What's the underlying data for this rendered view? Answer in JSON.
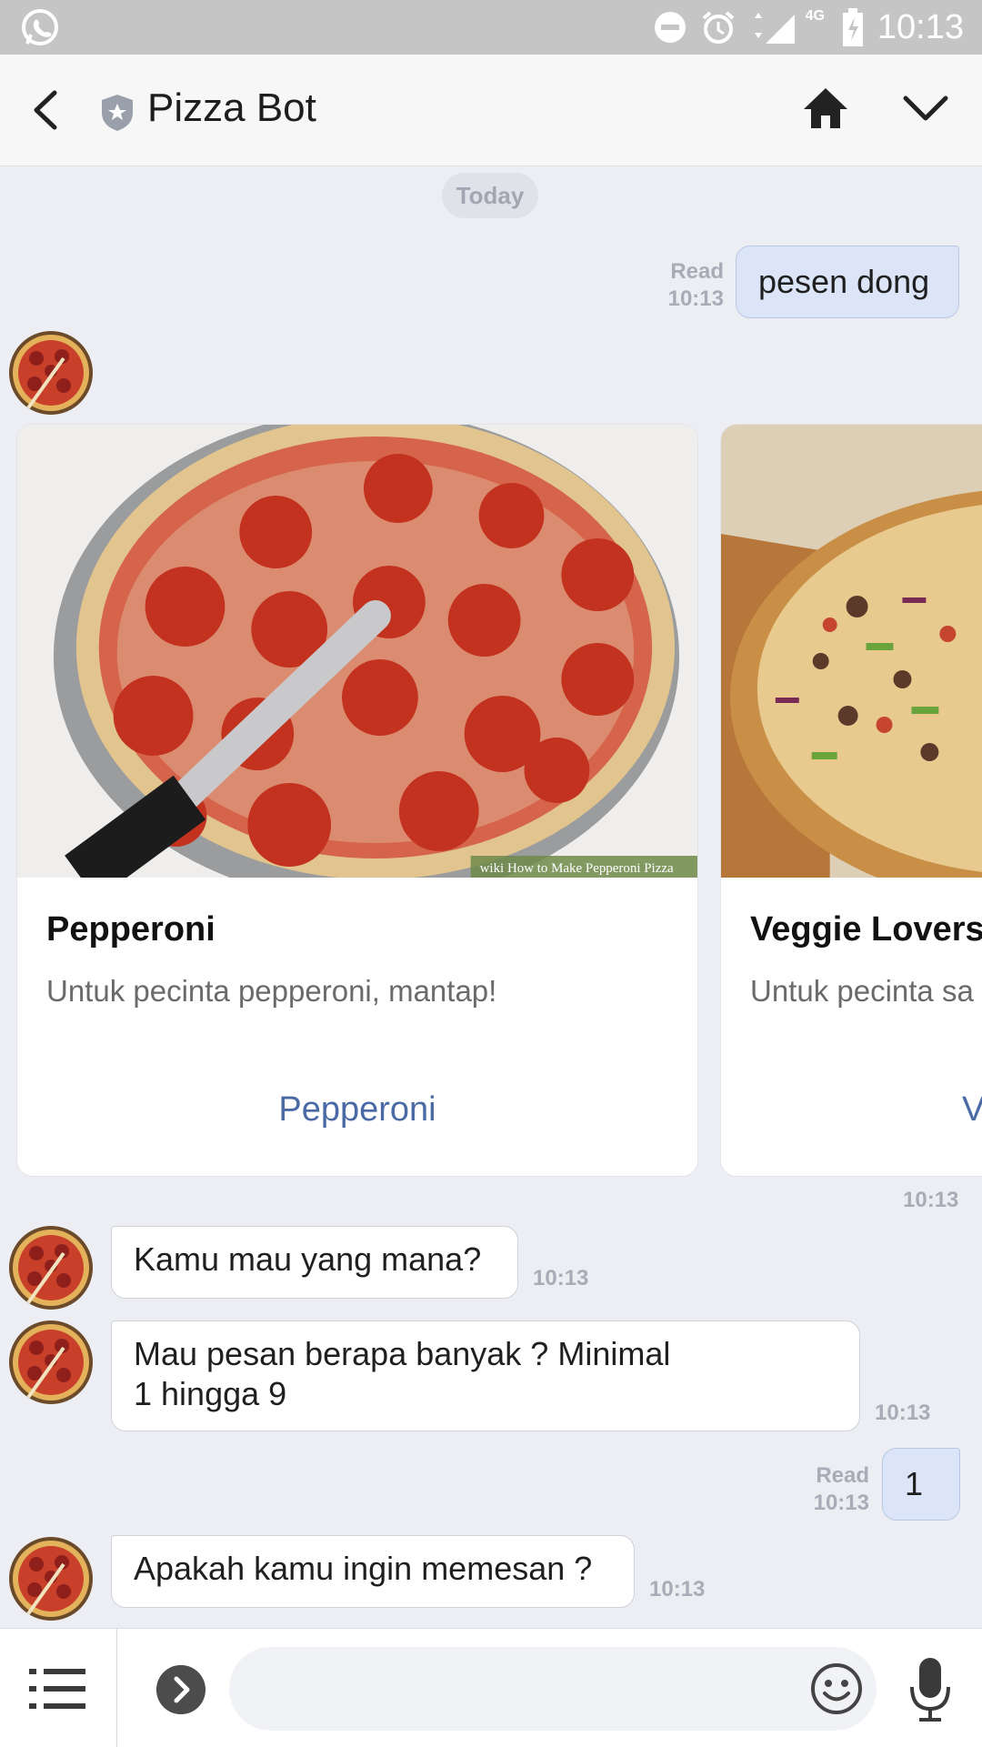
{
  "status_bar": {
    "time": "10:13",
    "network": "4G"
  },
  "header": {
    "title": "Pizza Bot"
  },
  "chat": {
    "date_label": "Today",
    "messages": [
      {
        "direction": "out",
        "text": "pesen dong",
        "status": "Read",
        "time": "10:13"
      },
      {
        "direction": "in",
        "type": "carousel",
        "time": "10:13"
      },
      {
        "direction": "in",
        "text": "Kamu mau yang mana?",
        "time": "10:13"
      },
      {
        "direction": "in",
        "text_line1": "Mau pesan berapa banyak ? Minimal",
        "text_line2": "1 hingga 9",
        "time": "10:13"
      },
      {
        "direction": "out",
        "text": "1",
        "status": "Read",
        "time": "10:13"
      },
      {
        "direction": "in",
        "text": "Apakah kamu ingin memesan ?",
        "time": "10:13"
      }
    ],
    "carousel": [
      {
        "title": "Pepperoni",
        "description": "Untuk pecinta pepperoni, mantap!",
        "action": "Pepperoni",
        "image_caption": "wiki How to Make Pepperoni Pizza"
      },
      {
        "title": "Veggie Lovers",
        "description": "Untuk pecinta sa",
        "action": "V"
      }
    ]
  },
  "input": {
    "placeholder": ""
  },
  "colors": {
    "accent": "#4a6aa5",
    "outgoing_bubble": "#dbe5f7",
    "background": "#edeef3"
  }
}
